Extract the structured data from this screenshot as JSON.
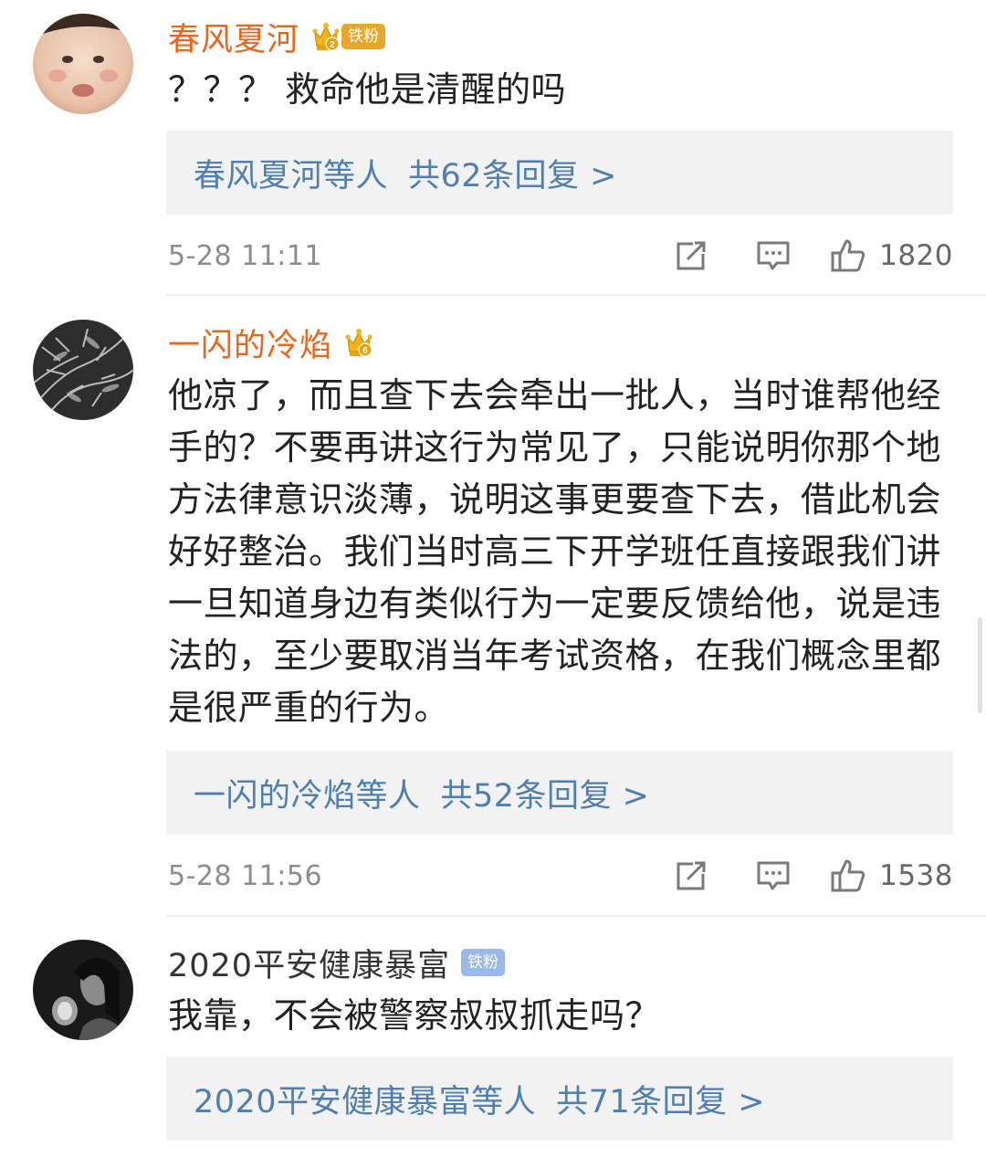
{
  "comments": [
    {
      "username": "春风夏河",
      "badge_level": "2",
      "badge_label": "铁粉",
      "text": "？？？ 救命他是清醒的吗",
      "replies_who": "春风夏河等人",
      "replies_count": "共62条回复 >",
      "time": "5-28 11:11",
      "likes": "1820"
    },
    {
      "username": "一闪的冷焰",
      "badge_level": "6",
      "text": "他凉了，而且查下去会牵出一批人，当时谁帮他经手的？不要再讲这行为常见了，只能说明你那个地方法律意识淡薄，说明这事更要查下去，借此机会好好整治。我们当时高三下开学班任直接跟我们讲一旦知道身边有类似行为一定要反馈给他，说是违法的，至少要取消当年考试资格，在我们概念里都是很严重的行为。",
      "replies_who": "一闪的冷焰等人",
      "replies_count": "共52条回复 >",
      "time": "5-28 11:56",
      "likes": "1538"
    },
    {
      "username": "2020平安健康暴富",
      "badge_label": "铁粉",
      "text": "我靠，不会被警察叔叔抓走吗？",
      "replies_who": "2020平安健康暴富等人",
      "replies_count": "共71条回复 >"
    }
  ],
  "icons": {
    "share": "share-icon",
    "comment": "comment-icon",
    "like": "thumbs-up-icon",
    "crown": "crown-icon"
  },
  "colors": {
    "username_highlight": "#e8671c",
    "reply_link": "#4f7fb1",
    "badge_gold": "#e9a62d",
    "badge_blue": "#9ab8e9"
  }
}
